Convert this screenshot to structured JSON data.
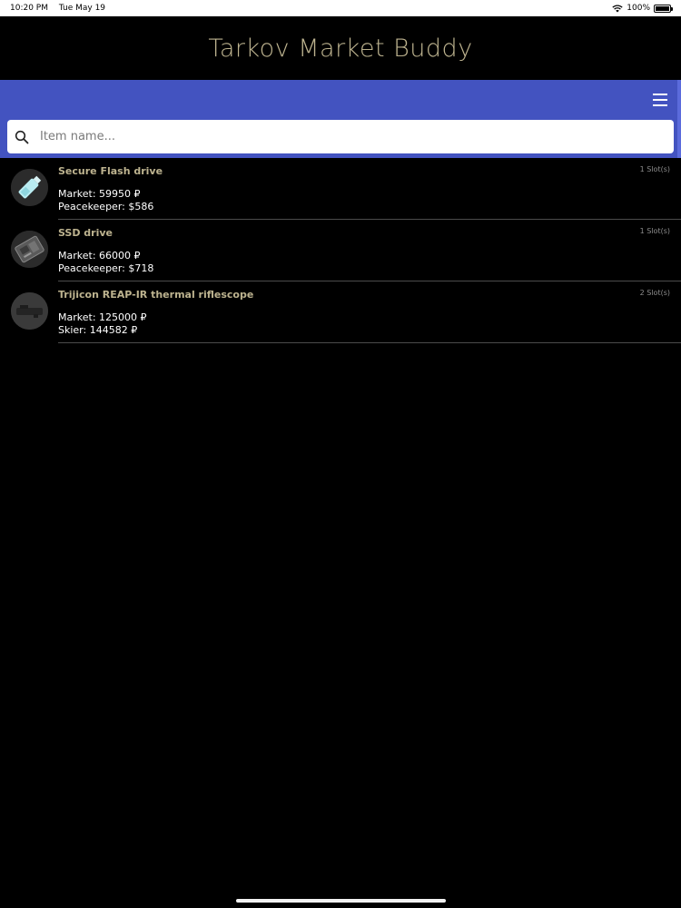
{
  "status_bar": {
    "time": "10:20 PM",
    "date": "Tue May 19",
    "battery": "100%",
    "icons": [
      "wifi-icon",
      "battery-icon"
    ]
  },
  "header": {
    "title": "Tarkov Market Buddy"
  },
  "toolbar": {
    "menu_icon": "menu-icon"
  },
  "search": {
    "placeholder": "Item name..."
  },
  "items": [
    {
      "name": "Secure Flash drive",
      "slots": "1 Slot(s)",
      "market": "Market: 59950 ₽",
      "trader": "Peacekeeper: $586",
      "icon": "flash-drive-icon"
    },
    {
      "name": "SSD drive",
      "slots": "1 Slot(s)",
      "market": "Market: 66000 ₽",
      "trader": "Peacekeeper: $718",
      "icon": "ssd-drive-icon"
    },
    {
      "name": "Trijicon REAP-IR thermal riflescope",
      "slots": "2 Slot(s)",
      "market": "Market: 125000 ₽",
      "trader": "Skier: 144582 ₽",
      "icon": "riflescope-icon"
    }
  ],
  "colors": {
    "toolbar": "#4353c0",
    "title": "#bdb38f",
    "background": "#000000"
  }
}
